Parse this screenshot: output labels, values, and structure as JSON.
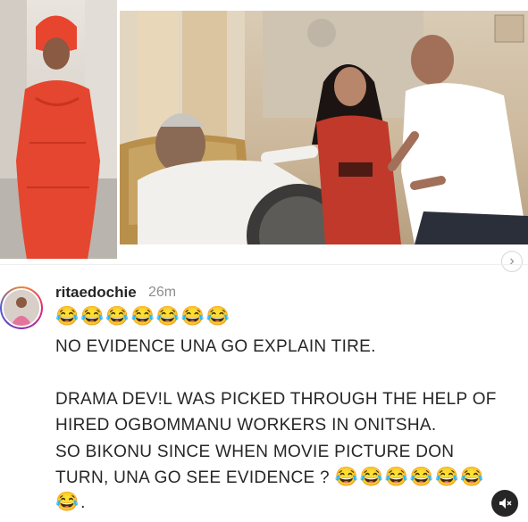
{
  "post": {
    "username": "ritaedochie",
    "time": "26m",
    "emoji_row": "😂😂😂😂😂😂😂",
    "line1": "NO EVIDENCE UNA GO EXPLAIN TIRE.",
    "para2_line1": "DRAMA DEV!L WAS PICKED THROUGH THE HELP OF",
    "para2_line2": "HIRED OGBOMMANU WORKERS IN ONITSHA.",
    "para3_line1": "SO BIKONU SINCE WHEN MOVIE PICTURE DON",
    "para3_line2_text": "TURN, UNA GO SEE EVIDENCE ?",
    "para3_line2_emoji": "😂😂😂😂😂😂",
    "para3_line3_emoji": "😂",
    "para3_line3_text": "."
  },
  "icons": {
    "scroll": "chevron-right-icon",
    "mute": "speaker-muted-icon"
  },
  "colors": {
    "text": "#262626",
    "muted": "#8e8e8e",
    "dress": "#e4462f"
  }
}
